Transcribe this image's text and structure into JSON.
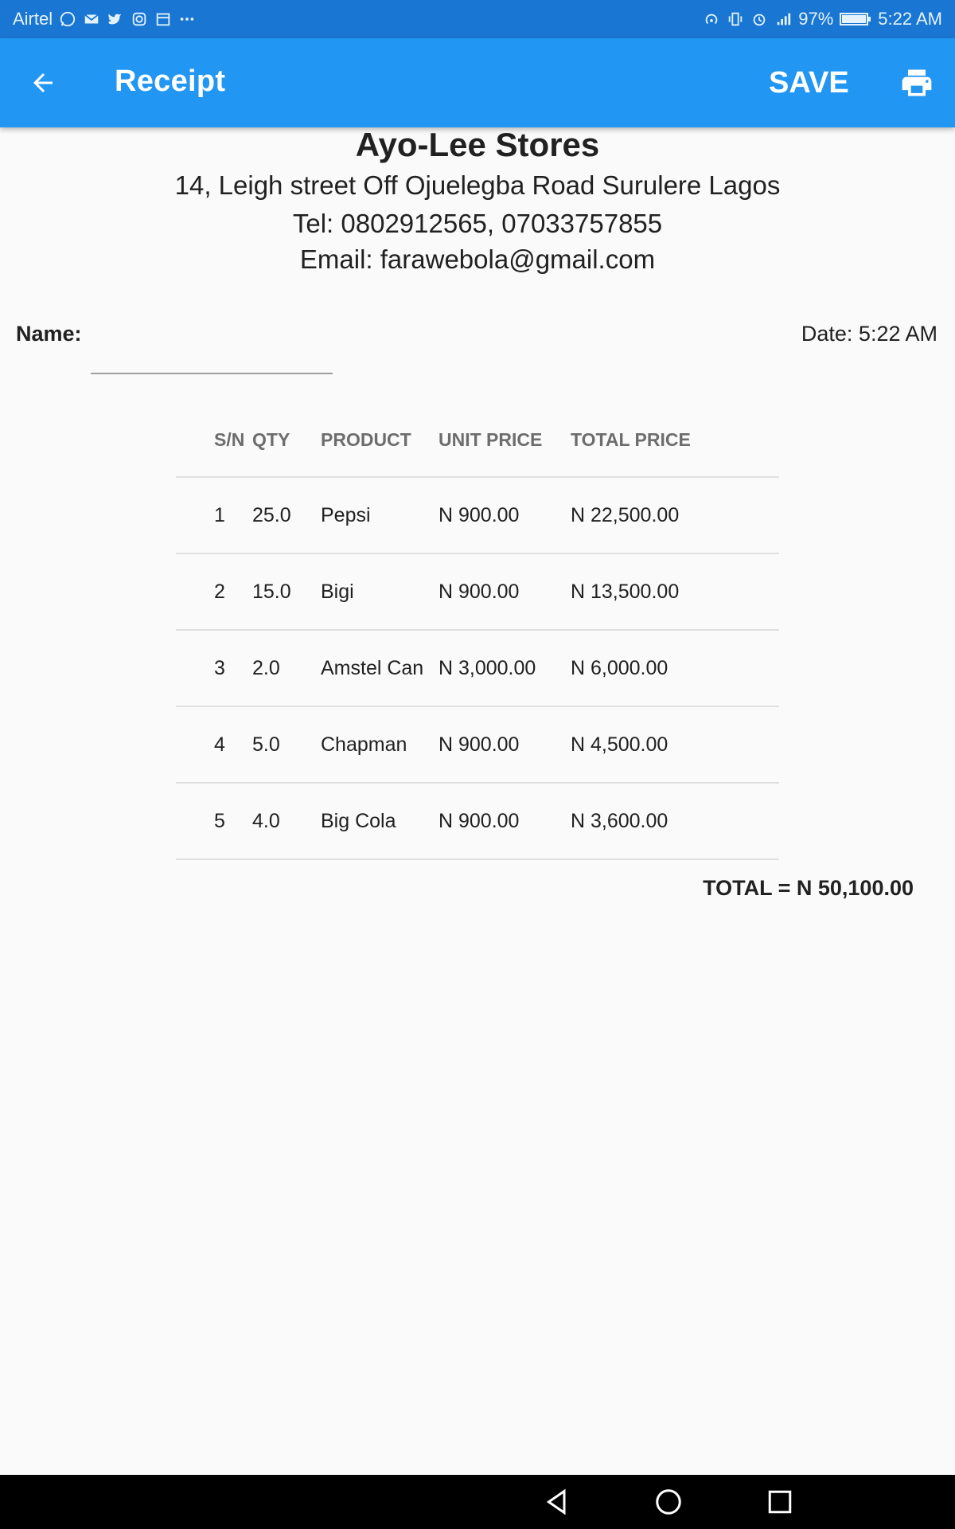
{
  "status_bar": {
    "carrier": "Airtel",
    "battery": "97%",
    "time": "5:22 AM",
    "icons_left": [
      "whatsapp-icon",
      "mail-icon",
      "twitter-icon",
      "instagram-icon",
      "calendar-icon",
      "more-dots-icon"
    ],
    "icons_right": [
      "hotspot-icon",
      "vibrate-icon",
      "alarm-icon",
      "signal-4g-icon",
      "battery-icon"
    ]
  },
  "app_bar": {
    "title": "Receipt",
    "save_label": "SAVE",
    "icons": [
      "back-arrow-icon",
      "print-icon"
    ]
  },
  "store": {
    "name": "Ayo-Lee Stores",
    "address": "14, Leigh street Off Ojuelegba Road Surulere Lagos",
    "tel": "Tel: 0802912565, 07033757855",
    "email": "Email: farawebola@gmail.com"
  },
  "customer": {
    "name_label": "Name:",
    "name_value": "",
    "date": "Date: 5:22 AM"
  },
  "table": {
    "headers": [
      "S/N",
      "QTY",
      "PRODUCT",
      "UNIT PRICE",
      "TOTAL PRICE"
    ],
    "rows": [
      [
        "1",
        "25.0",
        "Pepsi",
        "N 900.00",
        "N 22,500.00"
      ],
      [
        "2",
        "15.0",
        "Bigi",
        "N 900.00",
        "N 13,500.00"
      ],
      [
        "3",
        "2.0",
        "Amstel Can",
        "N 3,000.00",
        "N 6,000.00"
      ],
      [
        "4",
        "5.0",
        "Chapman",
        "N 900.00",
        "N 4,500.00"
      ],
      [
        "5",
        "4.0",
        "Big Cola",
        "N 900.00",
        "N 3,600.00"
      ]
    ]
  },
  "total": "TOTAL = N 50,100.00",
  "nav_bar": {
    "icons": [
      "nav-back-icon",
      "nav-home-icon",
      "nav-recents-icon"
    ]
  },
  "colors": {
    "app_bar": "#2196f3",
    "status_bar": "#1976d2",
    "background": "#fafafa"
  }
}
